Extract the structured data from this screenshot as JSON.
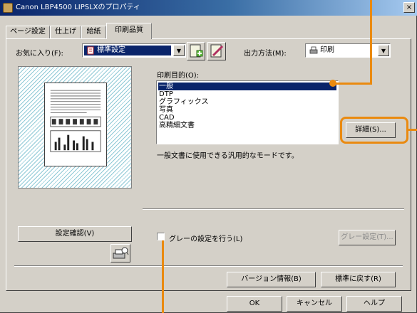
{
  "window": {
    "title": "Canon LBP4500 LIPSLXのプロパティ",
    "close_glyph": "×"
  },
  "tabs": [
    {
      "label": "ページ設定"
    },
    {
      "label": "仕上げ"
    },
    {
      "label": "給紙"
    },
    {
      "label": "印刷品質"
    }
  ],
  "active_tab": "印刷品質",
  "favorites": {
    "label": "お気に入り(F):",
    "value": "標準設定"
  },
  "output_method": {
    "label": "出力方法(M):",
    "value": "印刷"
  },
  "purpose": {
    "label": "印刷目的(O):",
    "items": [
      "一般",
      "DTP",
      "グラフィックス",
      "写真",
      "CAD",
      "高精細文書"
    ],
    "selected_index": 0,
    "description": "一般文書に使用できる汎用的なモードです。",
    "details_button": "詳細(S)..."
  },
  "view_settings_button": "設定確認(V)",
  "gray": {
    "checkbox_label": "グレーの設定を行う(L)",
    "checked": false,
    "settings_button": "グレー設定(T)..."
  },
  "version_button": "バージョン情報(B)",
  "defaults_button": "標準に戻す(R)",
  "footer": {
    "ok": "OK",
    "cancel": "キャンセル",
    "help": "ヘルプ"
  },
  "colors": {
    "callout": "#ea8a10",
    "selection": "#0a246a"
  }
}
